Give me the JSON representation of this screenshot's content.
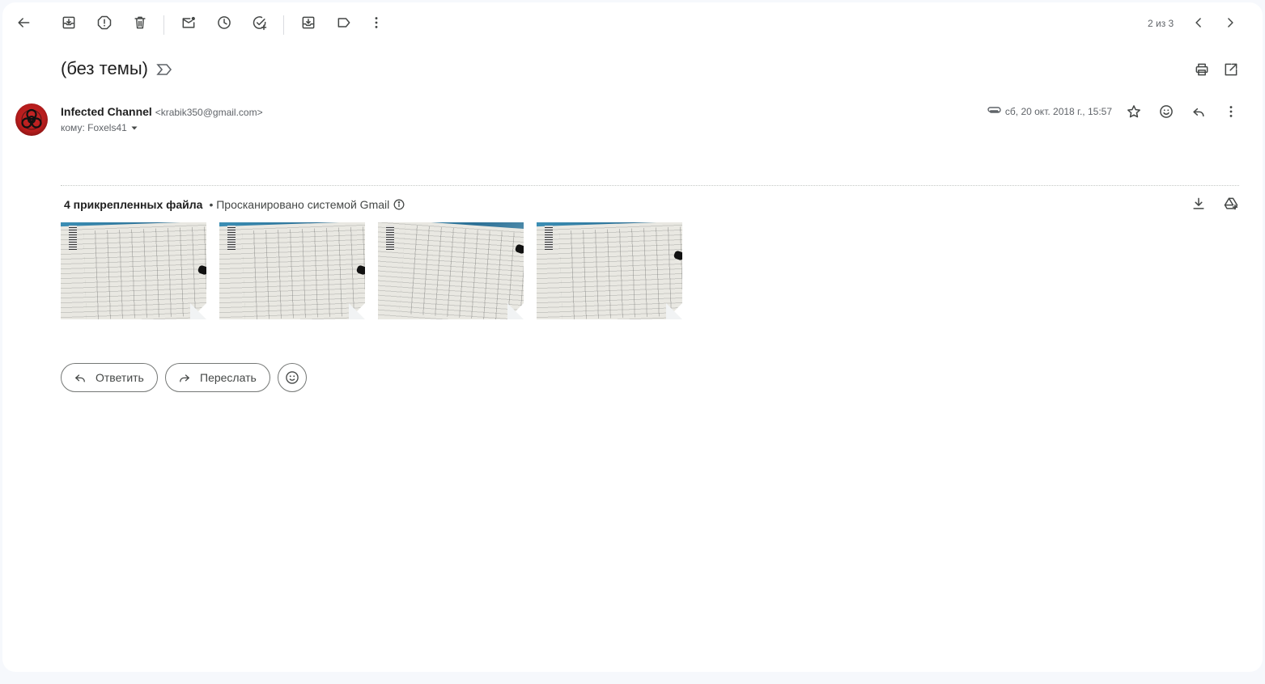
{
  "toolbar": {
    "back": "back-arrow-icon",
    "archive": "archive-icon",
    "spam": "report-spam-icon",
    "delete": "trash-icon",
    "mark_unread": "mark-unread-icon",
    "snooze": "snooze-clock-icon",
    "add_task": "add-task-icon",
    "move_to": "move-to-icon",
    "label": "label-icon",
    "more": "more-vert-icon",
    "counter": "2 из 3",
    "prev": "chevron-left-icon",
    "next": "chevron-right-icon"
  },
  "subject": "(без темы)",
  "header_actions": {
    "print": "print-icon",
    "open_new_window": "open-in-new-icon"
  },
  "message": {
    "sender_name": "Infected Channel",
    "sender_email": "<krabik350@gmail.com>",
    "recipient": "кому: Foxels41",
    "date": "сб, 20 окт. 2018 г., 15:57"
  },
  "attachments": {
    "count_label": "4 прикрепленных файла",
    "scan_label": "• Просканировано системой Gmail",
    "files": [
      {
        "thumb": "document-photo-1"
      },
      {
        "thumb": "document-photo-2"
      },
      {
        "thumb": "document-photo-3"
      },
      {
        "thumb": "document-photo-4"
      }
    ]
  },
  "actions": {
    "reply": "Ответить",
    "forward": "Переслать"
  },
  "colors": {
    "background": "#f6f8fc",
    "card": "#ffffff",
    "text": "#1f1f1f",
    "muted": "#5f6368",
    "avatar": "#b71c1c"
  }
}
